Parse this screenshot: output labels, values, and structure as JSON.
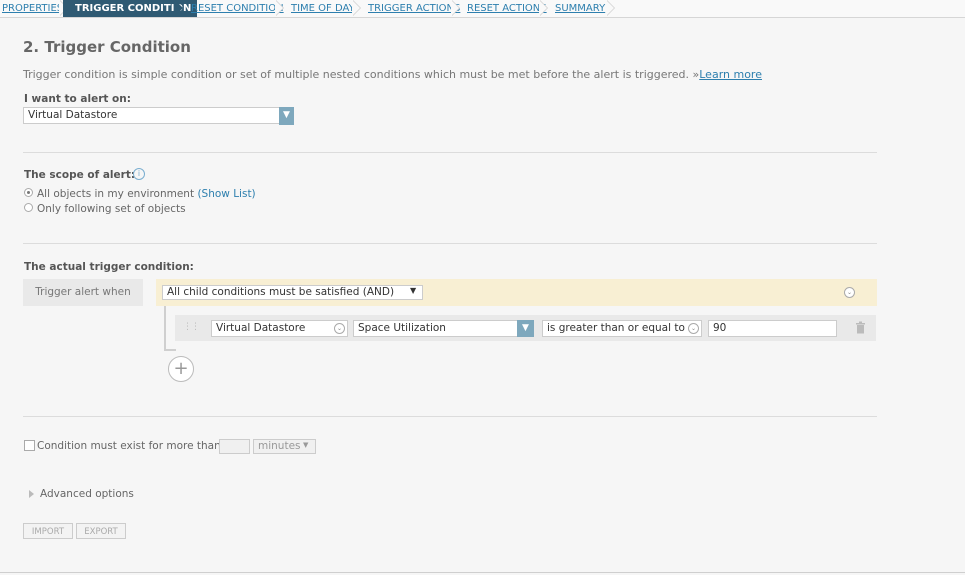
{
  "wizard": {
    "steps": [
      "PROPERTIES",
      "TRIGGER CONDITION",
      "RESET CONDITION",
      "TIME OF DAY",
      "TRIGGER ACTIONS",
      "RESET ACTIONS",
      "SUMMARY"
    ],
    "active_step": "TRIGGER CONDITION"
  },
  "page": {
    "title": "2. Trigger Condition",
    "description": "Trigger condition is simple condition or set of multiple nested conditions which must be met before the alert is triggered.",
    "learn_more_prefix": "»",
    "learn_more": "Learn more"
  },
  "alert_on": {
    "label": "I want to alert on:",
    "value": "Virtual Datastore"
  },
  "scope": {
    "label": "The scope of alert:",
    "options": [
      {
        "label": "All objects in my environment",
        "link": "(Show List)",
        "selected": true
      },
      {
        "label": "Only following set of objects",
        "selected": false
      }
    ]
  },
  "trigger": {
    "heading": "The actual trigger condition:",
    "when_label": "Trigger alert when",
    "mode": "All child conditions must be satisfied (AND)",
    "condition": {
      "object": "Virtual Datastore",
      "field": "Space Utilization",
      "operator": "is greater than or equal to",
      "value": "90"
    }
  },
  "duration": {
    "label": "Condition must exist for more than",
    "amount": "",
    "unit": "minutes",
    "checked": false
  },
  "advanced": {
    "label": "Advanced options"
  },
  "buttons": {
    "import": "IMPORT",
    "export": "EXPORT"
  },
  "colors": {
    "accent": "#2f5a73",
    "link": "#2d7fae",
    "trigger_bar": "#f8efd3"
  }
}
